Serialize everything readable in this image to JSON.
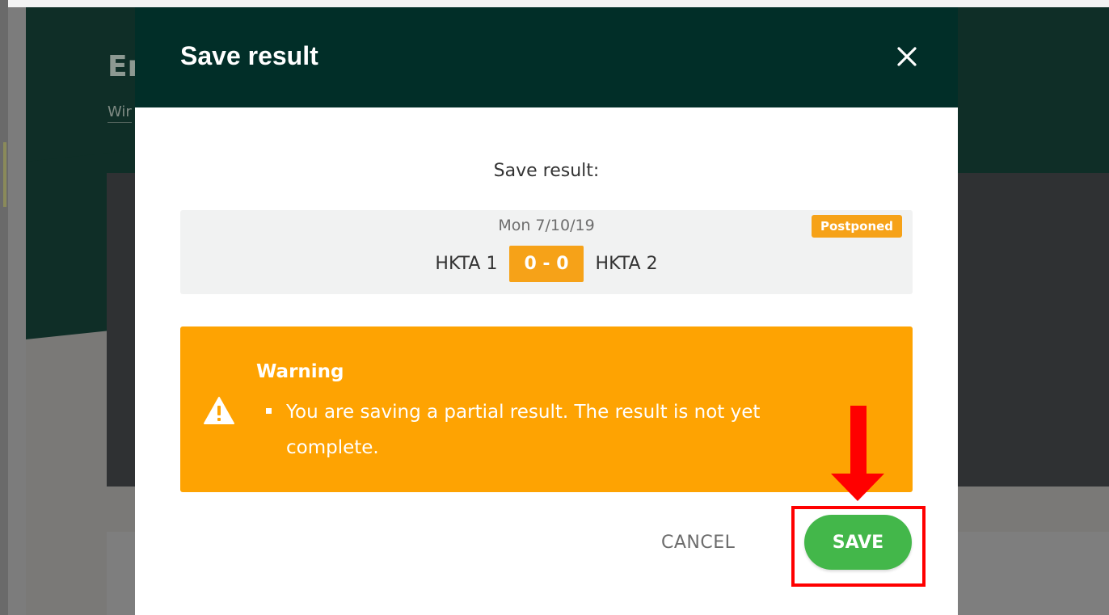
{
  "background": {
    "title_fragment": "Er",
    "subtitle_fragment": "Wir"
  },
  "modal": {
    "title": "Save result",
    "prompt": "Save result:",
    "match": {
      "date": "Mon 7/10/19",
      "status": "Postponed",
      "home_team": "HKTA 1",
      "score": "0 - 0",
      "away_team": "HKTA 2"
    },
    "warning": {
      "title": "Warning",
      "items": [
        "You are saving a partial result. The result is not yet complete."
      ]
    },
    "actions": {
      "cancel_label": "CANCEL",
      "save_label": "SAVE"
    }
  },
  "colors": {
    "header": "#012e28",
    "warning": "#fea302",
    "badge": "#f6a218",
    "save_button": "#43b74a",
    "annotation": "#ff0000"
  },
  "icons": {
    "close": "close-icon",
    "warning": "warning-triangle-icon"
  }
}
